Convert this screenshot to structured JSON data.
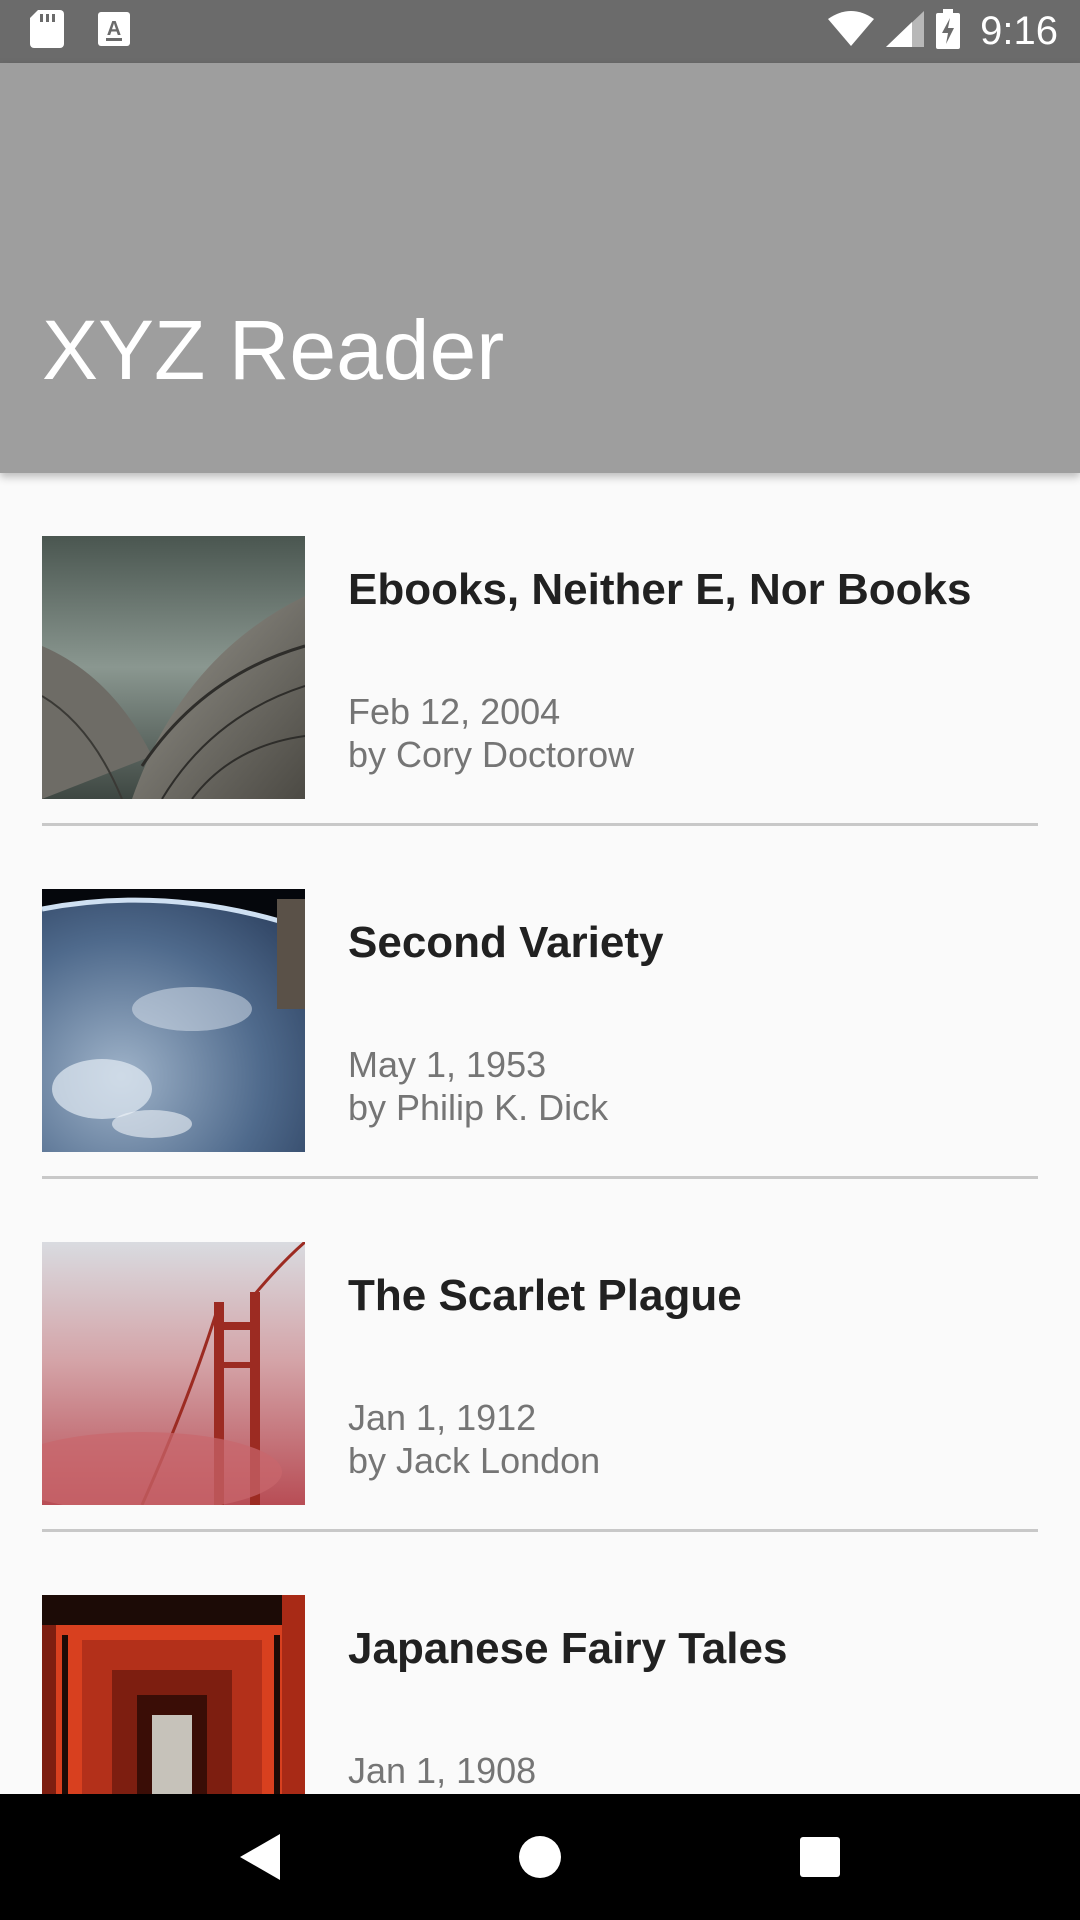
{
  "status_bar": {
    "time": "9:16",
    "left_icons": [
      "sd-card-icon",
      "keyboard-a-icon"
    ],
    "right_icons": [
      "wifi-icon",
      "cell-signal-icon",
      "battery-charging-icon"
    ]
  },
  "app_bar": {
    "title": "XYZ Reader",
    "color": "#9e9e9e"
  },
  "articles": [
    {
      "title": "Ebooks, Neither E, Nor Books",
      "date": "Feb 12, 2004",
      "author": "by Cory Doctorow",
      "thumbnail": "building-curves-photo"
    },
    {
      "title": "Second Variety",
      "date": "May 1, 1953",
      "author": "by Philip K. Dick",
      "thumbnail": "earth-from-space-photo"
    },
    {
      "title": "The Scarlet Plague",
      "date": "Jan 1, 1912",
      "author": "by Jack London",
      "thumbnail": "bridge-in-red-fog-photo"
    },
    {
      "title": "Japanese Fairy Tales",
      "date": "Jan 1, 1908",
      "author": "",
      "thumbnail": "torii-gates-photo"
    }
  ],
  "nav_bar": {
    "buttons": [
      "back-icon",
      "home-icon",
      "recents-icon"
    ]
  }
}
